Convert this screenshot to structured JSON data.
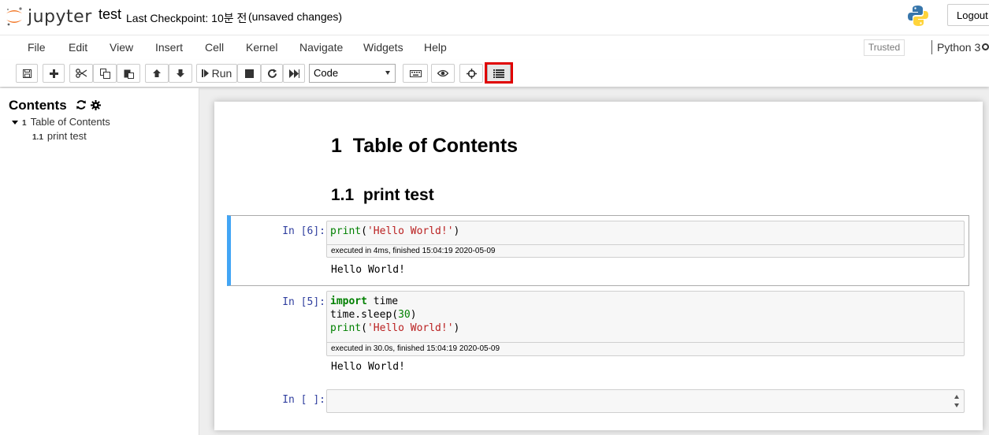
{
  "header": {
    "logo_text": "jupyter",
    "notebook_name": "test",
    "checkpoint": "Last Checkpoint: 10분 전",
    "autosave_status": "(unsaved changes)",
    "logout_label": "Logout"
  },
  "menubar": {
    "items": [
      "File",
      "Edit",
      "View",
      "Insert",
      "Cell",
      "Kernel",
      "Navigate",
      "Widgets",
      "Help"
    ],
    "trusted_label": "Trusted",
    "kernel_name": "Python 3"
  },
  "toolbar": {
    "run_label": "Run",
    "cell_type": "Code",
    "cell_type_options": [
      "Code"
    ],
    "buttons": [
      "save-icon",
      "plus-icon",
      "cut-icon",
      "copy-icon",
      "paste-icon",
      "arrow-up-icon",
      "arrow-down-icon",
      "run-icon",
      "stop-icon",
      "restart-icon",
      "fast-forward-icon",
      "keyboard-icon",
      "eye-icon",
      "crosshairs-icon",
      "list-icon"
    ]
  },
  "toc": {
    "title": "Contents",
    "items": [
      {
        "num": "1",
        "label": "Table of Contents"
      },
      {
        "num": "1.1",
        "label": "print test"
      }
    ]
  },
  "notebook": {
    "h1": "1  Table of Contents",
    "h2": "1.1  print test",
    "cells": [
      {
        "prompt": "In [6]:",
        "code_lines": [
          "print('Hello World!')"
        ],
        "exec_time": "executed in 4ms, finished 15:04:19 2020-05-09",
        "output": "Hello World!"
      },
      {
        "prompt": "In [5]:",
        "code_lines": [
          "import time",
          "time.sleep(30)",
          "print('Hello World!')"
        ],
        "exec_time": "executed in 30.0s, finished 15:04:19 2020-05-09",
        "output": "Hello World!"
      },
      {
        "prompt": "In [ ]:",
        "code_lines": [
          ""
        ]
      }
    ]
  },
  "colors": {
    "selected_cell_border": "#42a5f5",
    "highlight_box": "#e00000",
    "prompt": "#303f9f"
  }
}
